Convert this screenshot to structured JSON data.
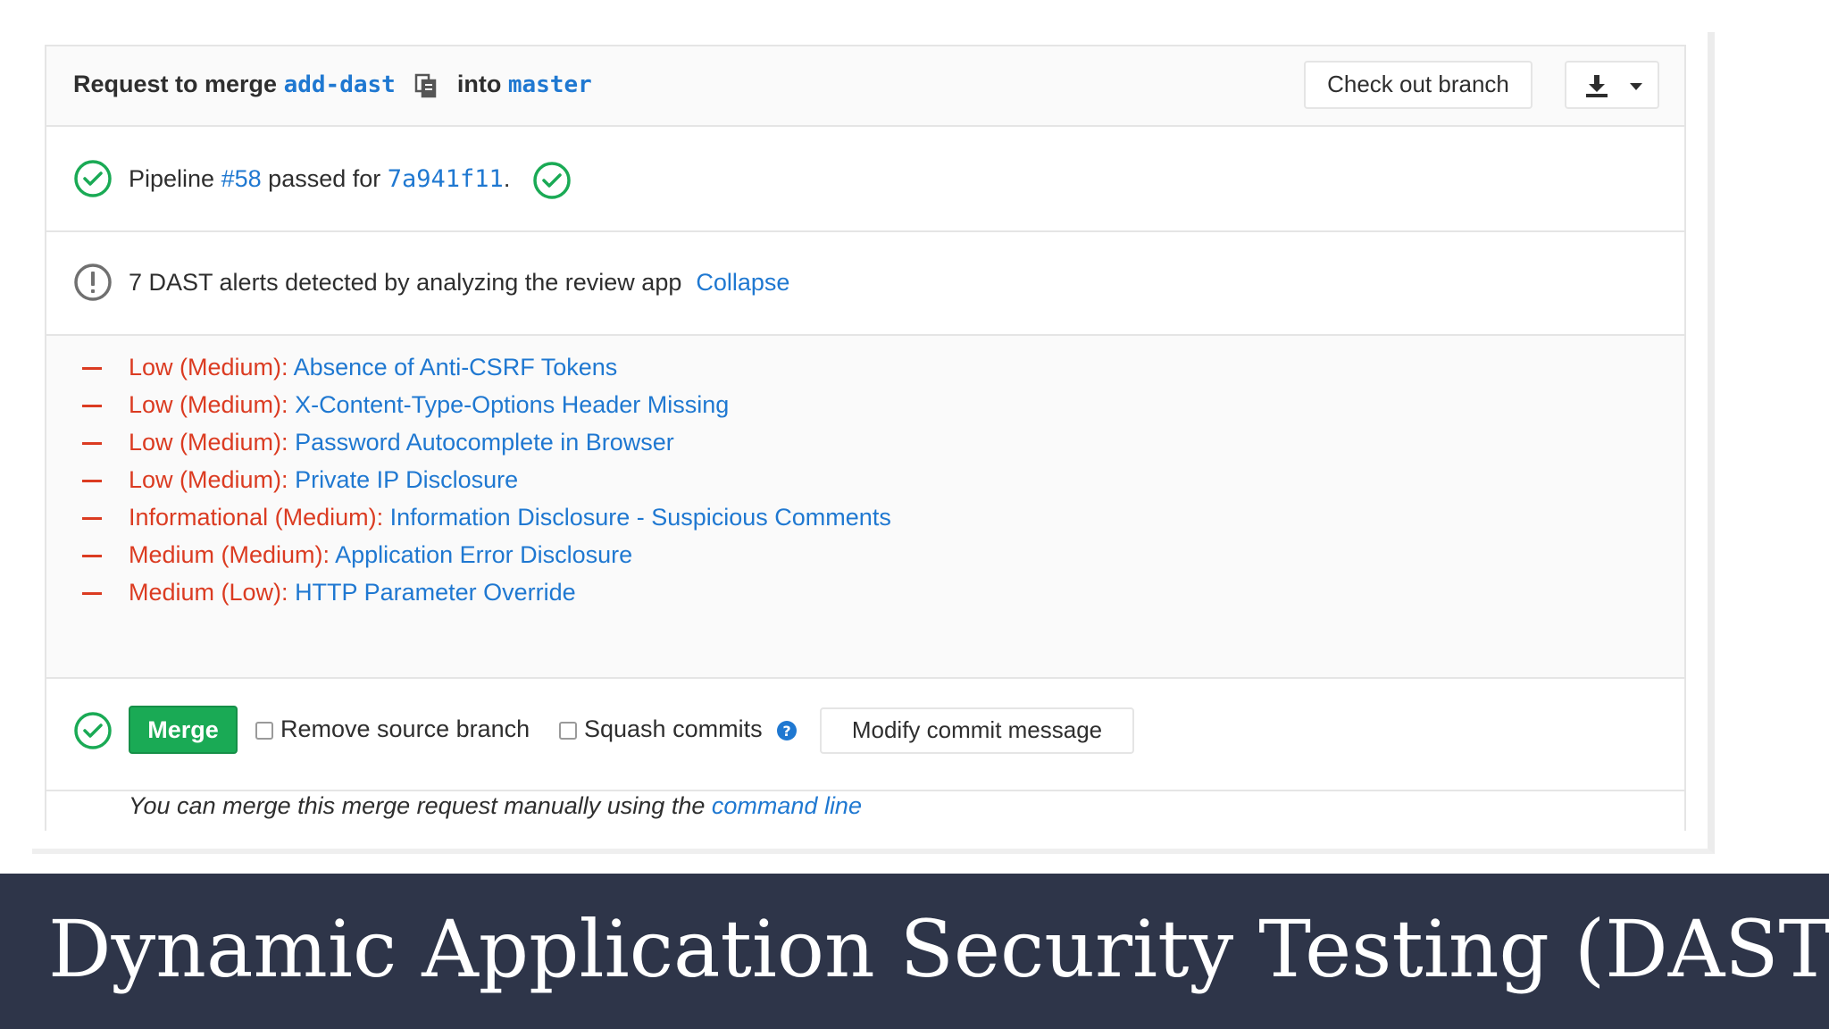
{
  "header": {
    "request_prefix": "Request to merge",
    "source_branch": "add-dast",
    "into_text": "into",
    "target_branch": "master",
    "checkout_button": "Check out branch",
    "download_icon": "download-icon",
    "caret_icon": "caret-down-icon"
  },
  "pipeline": {
    "prefix": "Pipeline",
    "id": "#58",
    "middle": "passed for",
    "commit": "7a941f11",
    "suffix": ".",
    "status_color": "#1aaa55"
  },
  "dast": {
    "summary": "7 DAST alerts detected by analyzing the review app",
    "collapse_label": "Collapse",
    "alerts": [
      {
        "severity": "Low (Medium):",
        "name": "Absence of Anti-CSRF Tokens"
      },
      {
        "severity": "Low (Medium):",
        "name": "X-Content-Type-Options Header Missing"
      },
      {
        "severity": "Low (Medium):",
        "name": "Password Autocomplete in Browser"
      },
      {
        "severity": "Low (Medium):",
        "name": "Private IP Disclosure"
      },
      {
        "severity": "Informational (Medium):",
        "name": "Information Disclosure - Suspicious Comments"
      },
      {
        "severity": "Medium (Medium):",
        "name": "Application Error Disclosure"
      },
      {
        "severity": "Medium (Low):",
        "name": "HTTP Parameter Override"
      }
    ],
    "severity_color": "#db3b21"
  },
  "merge": {
    "merge_button": "Merge",
    "remove_source_label": "Remove source branch",
    "squash_label": "Squash commits",
    "modify_button": "Modify commit message",
    "merge_color": "#1aaa55"
  },
  "manual": {
    "text": "You can merge this merge request manually using the",
    "link": "command line"
  },
  "banner": {
    "title": "Dynamic Application Security Testing (DAST)",
    "background": "#2e3549"
  }
}
